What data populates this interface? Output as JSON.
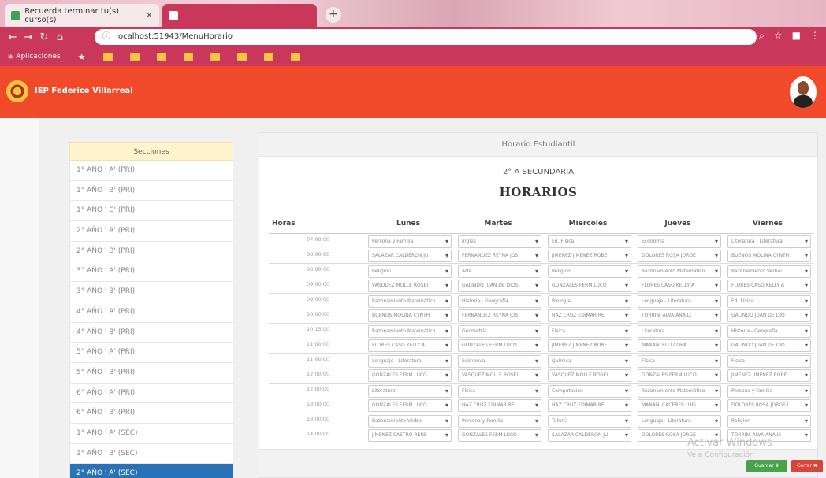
{
  "browser": {
    "tab1_title": "Recuerda terminar tu(s) curso(s)",
    "tab2_title": "",
    "url_scheme": "ⓘ",
    "url": "localhost:51943/MenuHorario",
    "bookmarks_label": "Aplicaciones"
  },
  "header": {
    "app_name": "IEP Federico Villarreal"
  },
  "sidebar": {
    "title": "Secciones",
    "items": [
      "1° AÑO ' A' (PRI)",
      "1° AÑO ' B' (PRI)",
      "1° AÑO ' C' (PRI)",
      "2° AÑO ' A' (PRI)",
      "2° AÑO ' B' (PRI)",
      "3° AÑO ' A' (PRI)",
      "3° AÑO ' B' (PRI)",
      "4° AÑO ' A' (PRI)",
      "4° AÑO ' B' (PRI)",
      "5° AÑO ' A' (PRI)",
      "5° AÑO ' B' (PRI)",
      "6° AÑO ' A' (PRI)",
      "6° AÑO ' B' (PRI)",
      "1° AÑO ' A' (SEC)",
      "1° AÑO ' B' (SEC)",
      "2° AÑO ' A' (SEC)"
    ],
    "selected_index": 15
  },
  "panel": {
    "header": "Horario Estudiantil",
    "grade": "2° A SECUNDARIA",
    "title": "HORARIOS",
    "columns": {
      "horas": "Horas",
      "lunes": "Lunes",
      "martes": "Martes",
      "miercoles": "Miercoles",
      "jueves": "Jueves",
      "viernes": "Viernes"
    },
    "rows": [
      {
        "t1": "07:00:00",
        "t2": "08:00:00",
        "cells": [
          [
            "Persona y Familia",
            "SALAZAR CALDERON JU"
          ],
          [
            "Inglés",
            "FERNANDEZ REYNA JOS"
          ],
          [
            "Ed. Física",
            "JIMENEZ JIMENEZ ROBE"
          ],
          [
            "Economía",
            "DOLORES ROSA JORGE I"
          ],
          [
            "Literatura - Literatura",
            "BUENOS MOLINA CYNTH"
          ]
        ]
      },
      {
        "t1": "08:00:00",
        "t2": "09:00:00",
        "cells": [
          [
            "Religión",
            "VASQUEZ MOLLE ROSEI"
          ],
          [
            "Arte",
            "GALINDO JUAN DE DIOS"
          ],
          [
            "Religión",
            "GONZALES FERM LUCO"
          ],
          [
            "Razonamiento Matemático",
            "FLORES CASO KELLY A"
          ],
          [
            "Razonamiento Verbal",
            "FLORES CASO KELLY A"
          ]
        ]
      },
      {
        "t1": "09:00:00",
        "t2": "10:00:00",
        "cells": [
          [
            "Razonamiento Matemático",
            "BUENOS MOLINA CYNTH"
          ],
          [
            "Historia - Geografía",
            "FERNANDEZ REYNA JOS"
          ],
          [
            "Biología",
            "HAZ CRUZ EDIMAR RE"
          ],
          [
            "Lenguaje - Literatura",
            "TORRINI ALVA ANA LI"
          ],
          [
            "Ed. Física",
            "GALINDO JUAN DE DIO"
          ]
        ]
      },
      {
        "t1": "10:15:00",
        "t2": "11:00:00",
        "cells": [
          [
            "Razonamiento Matemático",
            "FLORES CASO KELLY A"
          ],
          [
            "Geometría",
            "GONZALES FERM LUCO"
          ],
          [
            "Física",
            "JIMENEZ JIMENEZ ROBE"
          ],
          [
            "Literatura",
            "MANANI ELLI CORA"
          ],
          [
            "Historia - Geografía",
            "GALINDO JUAN DE DIO"
          ]
        ]
      },
      {
        "t1": "11:00:00",
        "t2": "12:00:00",
        "cells": [
          [
            "Lenguaje - Literatura",
            "GONZALES FERM LUCO"
          ],
          [
            "Economía",
            "VASQUEZ MOLLE ROSEI"
          ],
          [
            "Química",
            "VASQUEZ MOLLE ROSEI"
          ],
          [
            "Física",
            "GONZALES FERM LUCO"
          ],
          [
            "Física",
            "JIMENEZ JIMENEZ ROBE"
          ]
        ]
      },
      {
        "t1": "12:00:00",
        "t2": "13:00:00",
        "cells": [
          [
            "Literatura",
            "GONZALES FERM LUCO"
          ],
          [
            "Física",
            "HAZ CRUZ EDIMAR RE"
          ],
          [
            "Computación",
            "HAZ CRUZ EDIMAR RE"
          ],
          [
            "Razonamiento Matemático",
            "MANANI CACERES LUIS"
          ],
          [
            "Persona y Familia",
            "DOLORES ROSA JORGE I"
          ]
        ]
      },
      {
        "t1": "13:00:00",
        "t2": "14:00:00",
        "cells": [
          [
            "Razonamiento Verbal",
            "JIMENEZ CASTRO RENE"
          ],
          [
            "Persona y Familia",
            "GONZALES FERM LUCO"
          ],
          [
            "Tutoría",
            "SALAZAR CALDERON JU"
          ],
          [
            "Lenguaje - Literatura",
            "DOLORES ROSA JORGE I"
          ],
          [
            "Religión",
            "TORRINI ALVA ANA LI"
          ]
        ]
      }
    ]
  },
  "footer": {
    "watermark": "Activar Windows",
    "watermark_sub": "Ve a Configuración",
    "save_label": "Guardar ✚",
    "close_label": "Cerrar ✖"
  }
}
